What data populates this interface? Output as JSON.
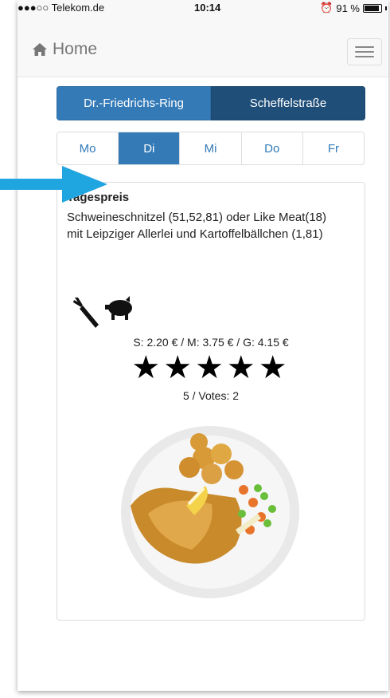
{
  "status": {
    "carrier": "●●●○○ Telekom.de",
    "time": "10:14",
    "battery": "91 %",
    "battery_level": 0.91
  },
  "nav": {
    "brand": "Home"
  },
  "locations": [
    "Dr.-Friedrichs-Ring",
    "Scheffelstraße"
  ],
  "days": [
    "Mo",
    "Di",
    "Mi",
    "Do",
    "Fr"
  ],
  "meal": {
    "title": "Tagespreis",
    "description": "Schweineschnitzel (51,52,81) oder Like Meat(18) mit Leipziger Allerlei und Kartoffelbällchen (1,81)",
    "prices": "S: 2.20 € / M: 3.75 € / G: 4.15 €",
    "stars": "★★★★★",
    "rating": "5 / Votes: 2"
  },
  "colors": {
    "primary": "#337ab7",
    "dark": "#1f4e79",
    "arrow": "#1fa5e0"
  }
}
